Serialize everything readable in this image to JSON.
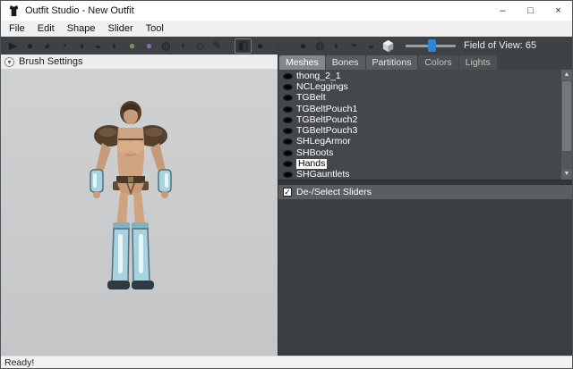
{
  "window": {
    "title": "Outfit Studio - New Outfit",
    "status": "Ready!",
    "minimize": "–",
    "maximize": "□",
    "close": "×"
  },
  "menu": {
    "items": [
      "File",
      "Edit",
      "Shape",
      "Slider",
      "Tool"
    ]
  },
  "toolbar": {
    "fov_label": "Field of View: 65",
    "fov_value": 65,
    "accent_color": "#2f86d2",
    "icons": [
      {
        "name": "select-tool",
        "glyph": "▶"
      },
      {
        "name": "mask-brush",
        "glyph": "●"
      },
      {
        "name": "inflate-brush",
        "glyph": "◕"
      },
      {
        "name": "deflate-brush",
        "glyph": "◔"
      },
      {
        "name": "move-brush",
        "glyph": "◑"
      },
      {
        "name": "smooth-brush",
        "glyph": "◒"
      },
      {
        "name": "undiff-brush",
        "glyph": "◐"
      },
      {
        "name": "weight-brush",
        "glyph": "●"
      },
      {
        "name": "color-brush",
        "glyph": "●"
      },
      {
        "name": "alpha-brush",
        "glyph": "◍"
      },
      {
        "name": "transform-tool",
        "glyph": "+"
      },
      {
        "name": "pivot-tool",
        "glyph": "◇"
      },
      {
        "name": "vertex-edit-tool",
        "glyph": "✎"
      },
      {
        "name": "xmirror-toggle",
        "glyph": "◧"
      },
      {
        "name": "connected-only-toggle",
        "glyph": "●"
      },
      {
        "name": "masked-vertices-toggle",
        "glyph": "◌"
      },
      {
        "name": "texture-toggle",
        "glyph": "●"
      },
      {
        "name": "wireframe-toggle",
        "glyph": "◍"
      },
      {
        "name": "lighting-toggle",
        "glyph": "◐"
      },
      {
        "name": "visibility-toggle",
        "glyph": "◓"
      },
      {
        "name": "segment-toggle",
        "glyph": "◒"
      }
    ]
  },
  "left": {
    "brush_settings": "Brush Settings",
    "collapse_glyph": "▾"
  },
  "right": {
    "tabs": [
      "Meshes",
      "Bones",
      "Partitions",
      "Colors",
      "Lights"
    ],
    "active_tab": "Meshes",
    "meshes": [
      "thong_2_1",
      "NCLeggings",
      "TGBelt",
      "TGBeltPouch1",
      "TGBeltPouch2",
      "TGBeltPouch3",
      "SHLegArmor",
      "SHBoots",
      "Hands",
      "SHGauntlets"
    ],
    "selected_mesh": "Hands",
    "sliders_header": "De-/Select Sliders",
    "sliders_checkbox_checked": true,
    "check_glyph": "✓",
    "scroll_up_glyph": "▲",
    "scroll_down_glyph": "▼"
  },
  "colors": {
    "toolbar_bg": "#3e4244",
    "panel_bg": "#44484a",
    "viewport_bg": "#c9cacb",
    "selection_bg": "#ffffff",
    "slider_accent": "#2f86d2"
  }
}
